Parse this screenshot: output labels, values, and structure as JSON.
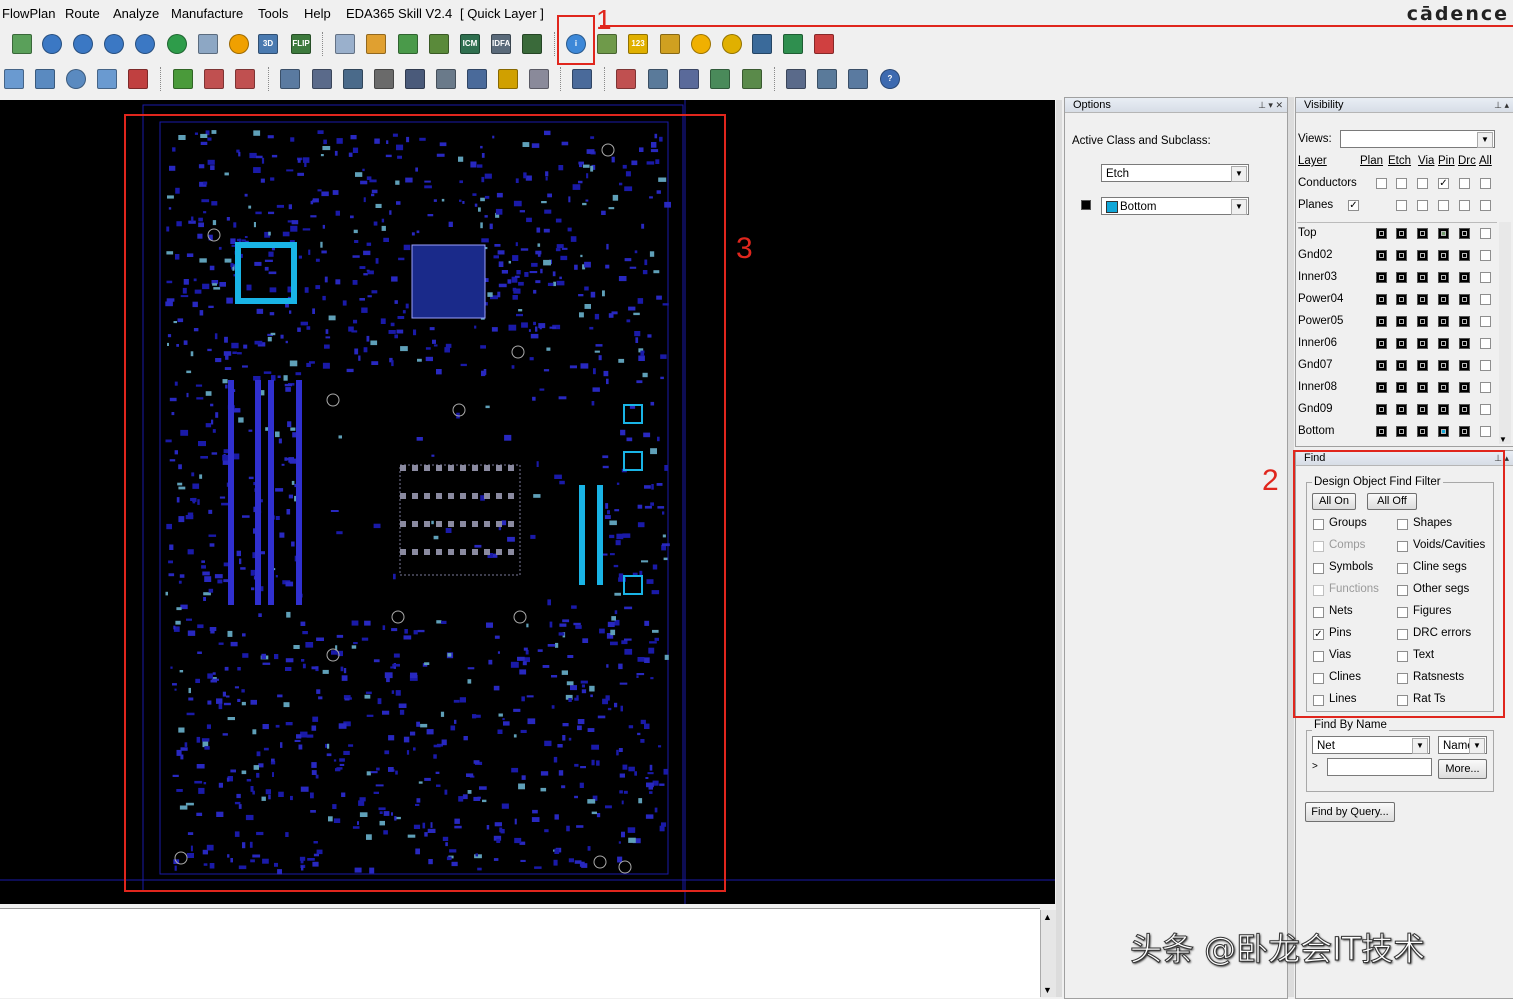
{
  "menu": {
    "items": [
      "FlowPlan",
      "Route",
      "Analyze",
      "Manufacture",
      "Tools",
      "Help",
      "EDA365 Skill V2.4",
      "[ Quick Layer ]"
    ],
    "brand": "cādence"
  },
  "annotations": {
    "n1": "1",
    "n2": "2",
    "n3": "3"
  },
  "options": {
    "title": "Options",
    "active_class_label": "Active Class and Subclass:",
    "class_value": "Etch",
    "subclass_value": "Bottom",
    "subclass_color": "#11a7d8"
  },
  "visibility": {
    "title": "Visibility",
    "views_label": "Views:",
    "views_value": "",
    "col_headers": [
      "Layer",
      "Plan",
      "Etch",
      "Via",
      "Pin",
      "Drc",
      "All"
    ],
    "group_rows": [
      {
        "label": "Conductors",
        "checks": [
          false,
          false,
          false,
          true,
          false,
          false
        ]
      },
      {
        "label": "Planes",
        "checks": [
          true,
          false,
          false,
          false,
          false,
          false
        ]
      }
    ],
    "layers": [
      "Top",
      "Gnd02",
      "Inner03",
      "Power04",
      "Power05",
      "Inner06",
      "Gnd07",
      "Inner08",
      "Gnd09",
      "Bottom"
    ]
  },
  "find": {
    "title": "Find",
    "filter_group": "Design Object Find Filter",
    "all_on": "All On",
    "all_off": "All Off",
    "left_items": [
      {
        "label": "Groups",
        "checked": false,
        "enabled": true
      },
      {
        "label": "Comps",
        "checked": false,
        "enabled": false
      },
      {
        "label": "Symbols",
        "checked": false,
        "enabled": true
      },
      {
        "label": "Functions",
        "checked": false,
        "enabled": false
      },
      {
        "label": "Nets",
        "checked": false,
        "enabled": true
      },
      {
        "label": "Pins",
        "checked": true,
        "enabled": true
      },
      {
        "label": "Vias",
        "checked": false,
        "enabled": true
      },
      {
        "label": "Clines",
        "checked": false,
        "enabled": true
      },
      {
        "label": "Lines",
        "checked": false,
        "enabled": true
      }
    ],
    "right_items": [
      {
        "label": "Shapes",
        "checked": false
      },
      {
        "label": "Voids/Cavities",
        "checked": false
      },
      {
        "label": "Cline segs",
        "checked": false
      },
      {
        "label": "Other segs",
        "checked": false
      },
      {
        "label": "Figures",
        "checked": false
      },
      {
        "label": "DRC errors",
        "checked": false
      },
      {
        "label": "Text",
        "checked": false
      },
      {
        "label": "Ratsnests",
        "checked": false
      },
      {
        "label": "Rat Ts",
        "checked": false
      }
    ],
    "find_by_name_group": "Find By Name",
    "type_value": "Net",
    "mode_value": "Name",
    "name_input": "",
    "more_btn": "More...",
    "query_btn": "Find by Query..."
  },
  "watermark": "头条 @卧龙会IT技术",
  "colors": {
    "accent_red": "#e0261d",
    "pcb_blue": "#1a1aa8",
    "pcb_cyan": "#1ab0e0"
  }
}
